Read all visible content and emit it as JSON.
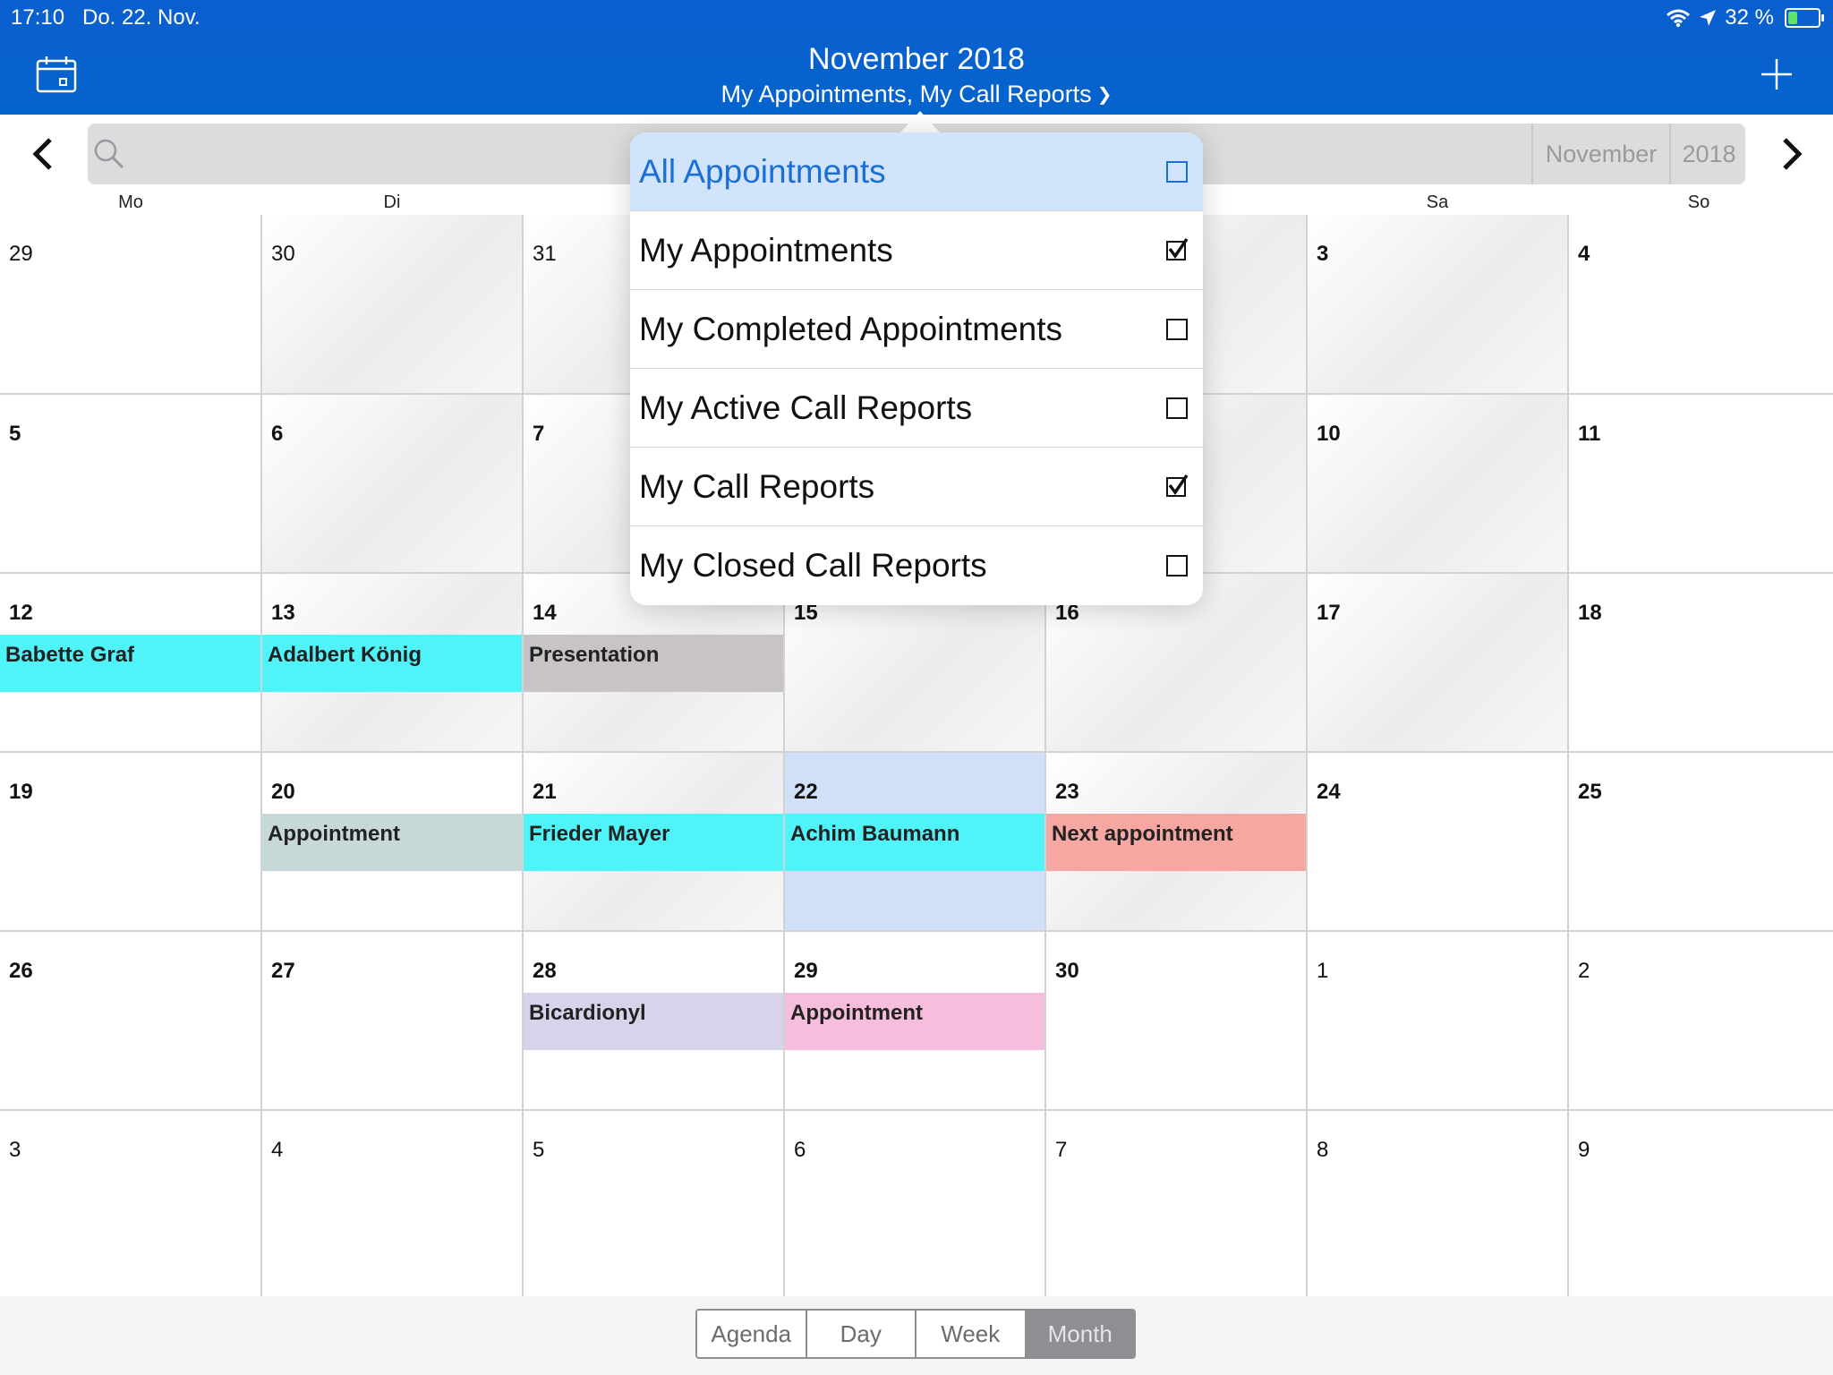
{
  "status": {
    "time": "17:10",
    "date": "Do. 22. Nov.",
    "battery": "32 %",
    "battery_level": 0.32
  },
  "header": {
    "title": "November 2018",
    "subtitle": "My Appointments, My Call Reports"
  },
  "search": {
    "month": "November",
    "year": "2018"
  },
  "weekdays": [
    "Mo",
    "Di",
    "",
    "",
    "",
    "Sa",
    "So"
  ],
  "calendar": {
    "weeks": [
      [
        "29",
        "30",
        "31",
        "",
        "",
        "3",
        "4"
      ],
      [
        "5",
        "6",
        "7",
        "",
        "",
        "10",
        "11"
      ],
      [
        "12",
        "13",
        "14",
        "15",
        "16",
        "17",
        "18"
      ],
      [
        "19",
        "20",
        "21",
        "22",
        "23",
        "24",
        "25"
      ],
      [
        "26",
        "27",
        "28",
        "29",
        "30",
        "1",
        "2"
      ],
      [
        "3",
        "4",
        "5",
        "6",
        "7",
        "8",
        "9"
      ]
    ],
    "events": {
      "babette": "Babette Graf",
      "adalbert": "Adalbert König",
      "presentation": "Presentation",
      "appointment20": "Appointment",
      "frieder": "Frieder Mayer",
      "achim": "Achim Baumann",
      "next": "Next appointment",
      "bicardionyl": "Bicardionyl",
      "appointment29": "Appointment"
    },
    "colors": {
      "cyan": "#4ff3f8",
      "gray": "#c8c3c6",
      "slate": "#c7d8d8",
      "salmon": "#f6a7a2",
      "lavender": "#d8d3ea",
      "pink": "#f6bddc",
      "today": "#cfe0f8"
    }
  },
  "filters": [
    {
      "label": "All Appointments",
      "checked": false
    },
    {
      "label": "My Appointments",
      "checked": true
    },
    {
      "label": "My Completed Appointments",
      "checked": false
    },
    {
      "label": "My Active Call Reports",
      "checked": false
    },
    {
      "label": "My Call Reports",
      "checked": true
    },
    {
      "label": "My Closed Call Reports",
      "checked": false
    }
  ],
  "views": [
    "Agenda",
    "Day",
    "Week",
    "Month"
  ],
  "active_view": "Month",
  "icons": [
    "calendar-icon",
    "plus-icon",
    "search-icon",
    "chevron-left-icon",
    "chevron-right-icon",
    "wifi-icon",
    "location-icon",
    "battery-icon",
    "chevron-down-icon",
    "checkbox-icon"
  ]
}
